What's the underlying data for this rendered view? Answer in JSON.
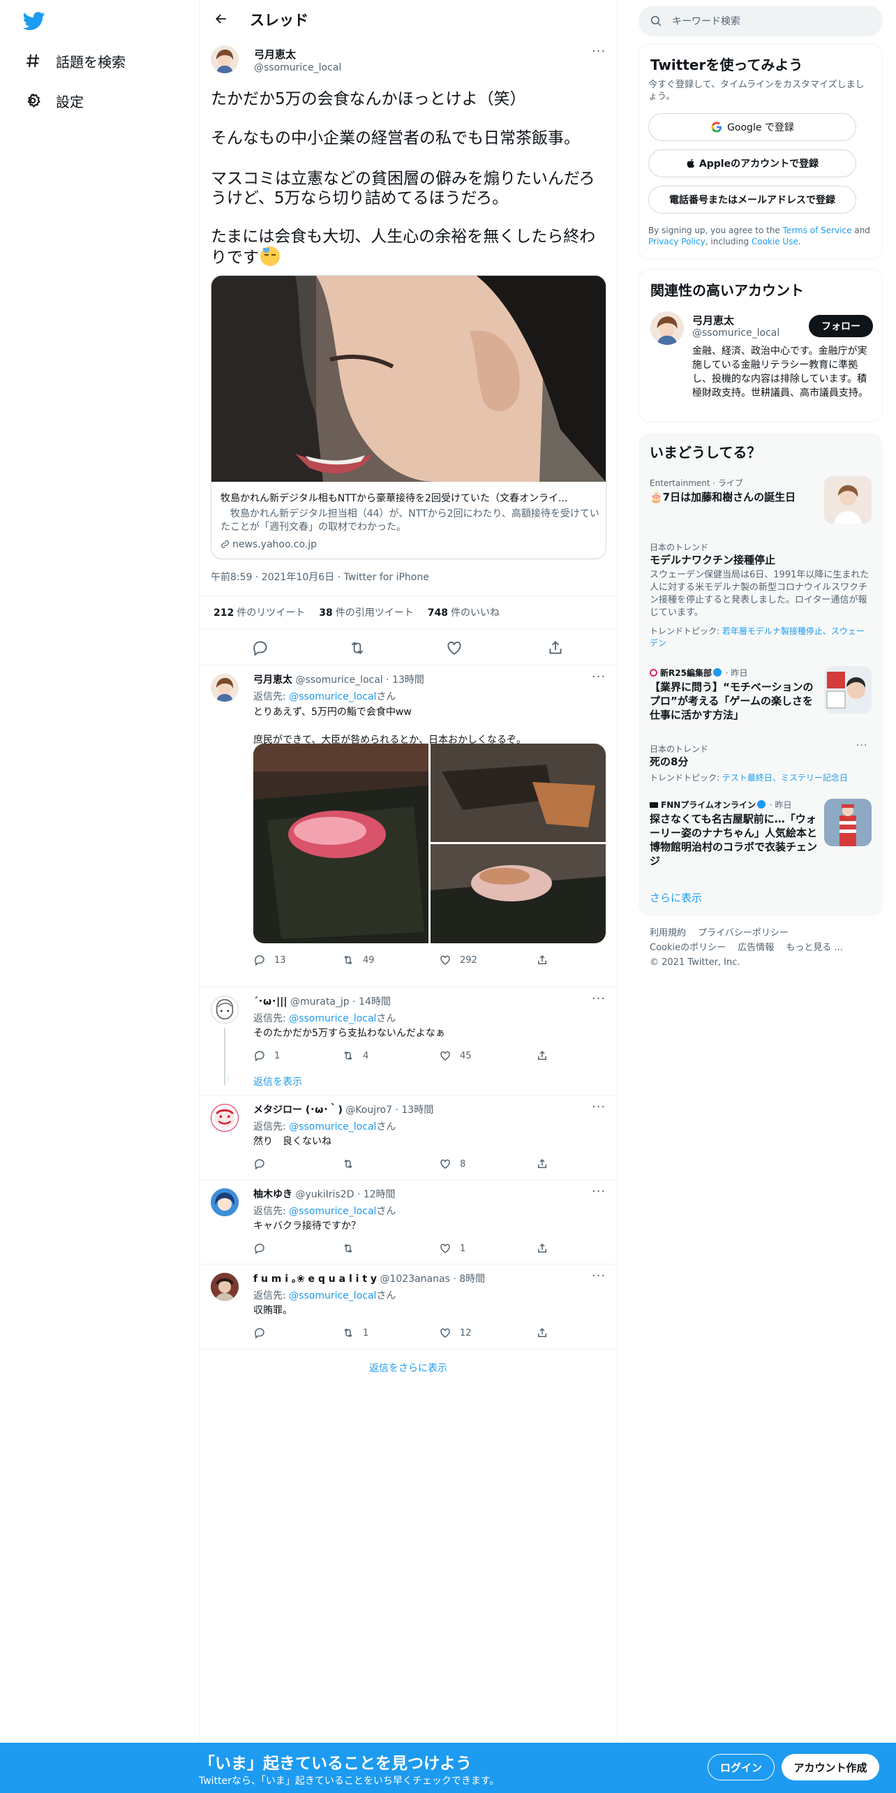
{
  "nav": {
    "logo_icon": "twitter-bird-icon",
    "items": [
      {
        "icon": "hashtag-icon",
        "label": "話題を検索"
      },
      {
        "icon": "gear-icon",
        "label": "設定"
      }
    ]
  },
  "header": {
    "title": "スレッド",
    "back_icon": "arrow-left-icon"
  },
  "focal_tweet": {
    "name": "弓月恵太",
    "handle": "@ssomurice_local",
    "paragraphs": [
      "たかだか5万の会食なんかほっとけよ（笑）",
      "そんなもの中小企業の経営者の私でも日常茶飯事。",
      "マスコミは立憲などの貧困層の僻みを煽りたいんだろうけど、5万なら切り詰めてるほうだろ。",
      "たまには会食も大切、人生心の余裕を無くしたら終わりです"
    ],
    "card": {
      "title": "牧島かれん新デジタル相もNTTから豪華接待を2回受けていた（文春オンライ...",
      "description": "　牧島かれん新デジタル担当相（44）が、NTTから2回にわたり、高額接待を受けていたことが「週刊文春」の取材でわかった。",
      "domain": "news.yahoo.co.jp"
    },
    "timestamp": "午前8:59 · 2021年10月6日 · Twitter for iPhone",
    "stats": {
      "retweets": "212",
      "retweets_label": "件のリツイート",
      "quotes": "38",
      "quotes_label": "件の引用ツイート",
      "likes": "748",
      "likes_label": "件のいいね"
    }
  },
  "replies": [
    {
      "name": "弓月恵太",
      "handle": "@ssomurice_local",
      "time": "13時間",
      "to_prefix": "返信先: ",
      "to": "@ssomurice_local",
      "to_suffix": "さん",
      "text": "とりあえず、5万円の鮨で会食中ww",
      "text2": "庶民ができて、大臣が咎められるとか、日本おかしくなるぞ。",
      "reply_count": "13",
      "retweet_count": "49",
      "like_count": "292"
    },
    {
      "name": "´･ω･|||",
      "handle": "@murata_jp",
      "time": "14時間",
      "to_prefix": "返信先: ",
      "to": "@ssomurice_local",
      "to_suffix": "さん",
      "text": "そのたかだか5万すら支払わないんだよなぁ",
      "reply_count": "1",
      "retweet_count": "4",
      "like_count": "45",
      "show_replies": "返信を表示"
    },
    {
      "name": "メタジロー (･ω･｀)",
      "handle": "@Koujro7",
      "time": "13時間",
      "to_prefix": "返信先: ",
      "to": "@ssomurice_local",
      "to_suffix": "さん",
      "text": "然り　良くないね",
      "reply_count": "",
      "retweet_count": "",
      "like_count": "8"
    },
    {
      "name": "柚木ゆき",
      "handle": "@yukiIris2D",
      "time": "12時間",
      "to_prefix": "返信先: ",
      "to": "@ssomurice_local",
      "to_suffix": "さん",
      "text": "キャバクラ接待ですか？",
      "reply_count": "",
      "retweet_count": "",
      "like_count": "1"
    },
    {
      "name": "f u m i ｡❀ e q u a l i t y",
      "handle": "@1023ananas",
      "time": "8時間",
      "to_prefix": "返信先: ",
      "to": "@ssomurice_local",
      "to_suffix": "さん",
      "text": "収賄罪。",
      "reply_count": "",
      "retweet_count": "1",
      "like_count": "12"
    }
  ],
  "show_more_replies": "返信をさらに表示",
  "right": {
    "search_placeholder": "キーワード検索",
    "signup_panel": {
      "title": "Twitterを使ってみよう",
      "subtitle": "今すぐ登録して、タイムラインをカスタマイズしましょう。",
      "google_btn": "Google で登録",
      "apple_btn": "Appleのアカウントで登録",
      "phone_btn": "電話番号またはメールアドレスで登録",
      "terms_1": "By signing up, you agree to the ",
      "terms_link1": "Terms of Service",
      "terms_2": " and ",
      "terms_link2": "Privacy Policy",
      "terms_3": ", including ",
      "terms_link3": "Cookie Use",
      "terms_4": "."
    },
    "related": {
      "title": "関連性の高いアカウント",
      "name": "弓月恵太",
      "handle": "@ssomurice_local",
      "follow": "フォロー",
      "bio": "金融、経済、政治中心です。金融庁が実施している金融リテラシー教育に準拠し、投機的な内容は排除しています。積極財政支持。世耕議員、高市議員支持。"
    },
    "trends": {
      "title": "いまどうしてる？",
      "items": [
        {
          "meta": "Entertainment · ライブ",
          "title": "🎂7日は加藤和樹さんの誕生日"
        },
        {
          "meta": "日本のトレンド",
          "title": "モデルナワクチン接種停止",
          "desc": "スウェーデン保健当局は6日、1991年以降に生まれた人に対する米モデルナ製の新型コロナウイルスワクチン接種を停止すると発表しました。ロイター通信が報じています。",
          "topic_label": "トレンドトピック: ",
          "topics": "若年層モデルナ製接種停止、スウェーデン"
        },
        {
          "meta_source": "新R25編集部",
          "meta_time": " · 昨日",
          "title": "【業界に問う】“モチベーションのプロ”が考える「ゲームの楽しさを仕事に活かす方法」"
        },
        {
          "meta": "日本のトレンド",
          "title": "死の8分",
          "topic_label": "トレンドトピック: ",
          "topics": "テスト最終日、ミステリー記念日"
        },
        {
          "meta_source": "FNNプライムオンライン",
          "meta_time": " · 昨日",
          "title": "探さなくても名古屋駅前に…「ウォーリー姿のナナちゃん」人気絵本と博物館明治村のコラボで衣装チェンジ"
        }
      ],
      "show_more": "さらに表示"
    },
    "footer": {
      "l1": "利用規約",
      "l2": "プライバシーポリシー",
      "l3": "Cookieのポリシー",
      "l4": "広告情報",
      "l5": "もっと見る ...",
      "copyright": "© 2021 Twitter, Inc."
    }
  },
  "bottom_bar": {
    "title": "「いま」起きていることを見つけよう",
    "subtitle": "Twitterなら、「いま」起きていることをいち早くチェックできます。",
    "login": "ログイン",
    "signup": "アカウント作成"
  },
  "colors": {
    "accent": "#1d9bf0",
    "text": "#0f1419",
    "muted": "#536471",
    "border": "#eff3f4"
  }
}
